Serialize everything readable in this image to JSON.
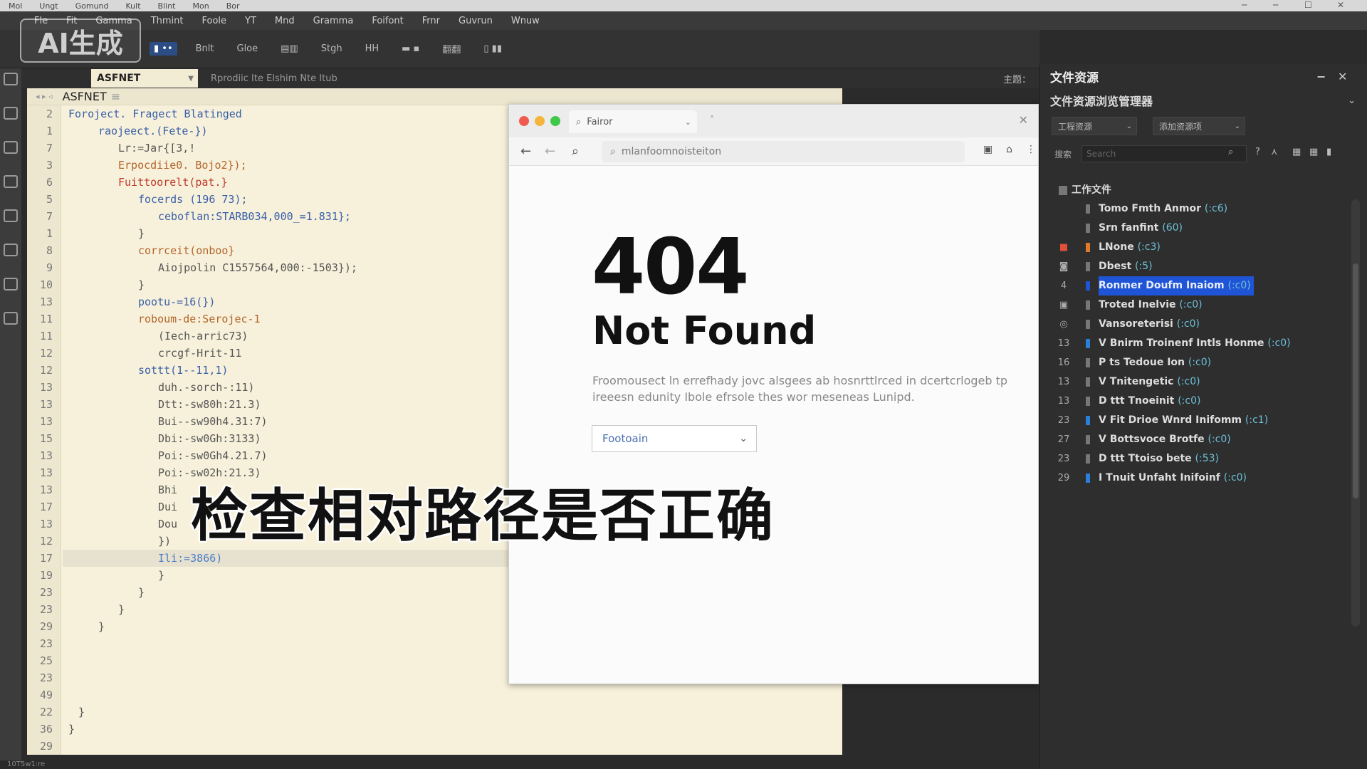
{
  "titlebar": {
    "items": [
      "Mol",
      "Ungt",
      "Gomund",
      "Kult",
      "Blint",
      "Mon",
      "Bor"
    ],
    "minimize": "─",
    "maximize": "☐",
    "close": "✕"
  },
  "watermark": "AI生成",
  "menubar": {
    "items": [
      "Fle",
      "Fit",
      "Gamma",
      "Thmint",
      "Foole",
      "YT",
      "Mnd",
      "Gramma",
      "Foifont",
      "Frnr",
      "Guvrun",
      "Wnuw"
    ]
  },
  "toolbar": {
    "items": [
      "Bnlt",
      "Gloe",
      "Stgh",
      "HH",
      "翻翻"
    ]
  },
  "editor_tabs": {
    "active_tab": "ASFNET",
    "path": "Rprodiic Ite Elshim Nte Itub",
    "right_label": "主题："
  },
  "editor": {
    "header_tab": "ASFNET",
    "lines": [
      {
        "num": "2",
        "indent": 0,
        "text": "Foroject. Fragect Blatinged",
        "color": "c-kw"
      },
      {
        "num": "1",
        "indent": 3,
        "text": "raojeect.(Fete-})",
        "color": "c-kw"
      },
      {
        "num": "7",
        "indent": 5,
        "text": "Lr:=Jar{[3‚!",
        "color": "c-plain"
      },
      {
        "num": "3",
        "indent": 5,
        "text": "Erpocdiie0. Bojo2});",
        "color": "c-orange"
      },
      {
        "num": "6",
        "indent": 5,
        "text": "Fuittoorelt(pat.}",
        "color": "c-red"
      },
      {
        "num": "5",
        "indent": 7,
        "text": "focerds (196 73);",
        "color": "c-kw"
      },
      {
        "num": "7",
        "indent": 9,
        "text": "ceboflan:STARB034,000_=1.831};",
        "color": "c-kw"
      },
      {
        "num": "1",
        "indent": 7,
        "text": "}",
        "color": "c-plain"
      },
      {
        "num": "8",
        "indent": 7,
        "text": "corrceit(onboo}",
        "color": "c-orange"
      },
      {
        "num": "9",
        "indent": 9,
        "text": "Aiojpolin C1557564,000:-1503});",
        "color": "c-plain"
      },
      {
        "num": "10",
        "indent": 7,
        "text": "}",
        "color": "c-plain"
      },
      {
        "num": "13",
        "indent": 7,
        "text": "pootu-=16(})",
        "color": "c-kw"
      },
      {
        "num": "11",
        "indent": 7,
        "text": "roboum-de:Serojec-1",
        "color": "c-orange"
      },
      {
        "num": "11",
        "indent": 9,
        "text": "(Iech-arric73)",
        "color": "c-plain"
      },
      {
        "num": "12",
        "indent": 9,
        "text": "crcgf-Hrit-11",
        "color": "c-plain"
      },
      {
        "num": "12",
        "indent": 7,
        "text": "sottt(1--11,1)",
        "color": "c-kw"
      },
      {
        "num": "13",
        "indent": 9,
        "text": "duh.-sorch-:11)",
        "color": "c-plain"
      },
      {
        "num": "13",
        "indent": 9,
        "text": "Dtt:-sw80h:21.3)",
        "color": "c-plain"
      },
      {
        "num": "13",
        "indent": 9,
        "text": "Bui--sw90h4.31:7)",
        "color": "c-plain"
      },
      {
        "num": "15",
        "indent": 9,
        "text": "Dbi:-sw0Gh:3133)",
        "color": "c-plain"
      },
      {
        "num": "13",
        "indent": 9,
        "text": "Poi:-sw0Gh4.21.7)",
        "color": "c-plain"
      },
      {
        "num": "13",
        "indent": 9,
        "text": "Poi:-sw02h:21.3)",
        "color": "c-plain"
      },
      {
        "num": "13",
        "indent": 9,
        "text": "Bhi",
        "color": "c-plain"
      },
      {
        "num": "17",
        "indent": 9,
        "text": "Dui",
        "color": "c-plain"
      },
      {
        "num": "13",
        "indent": 9,
        "text": "Dou",
        "color": "c-plain"
      },
      {
        "num": "12",
        "indent": 9,
        "text": "})",
        "color": "c-plain"
      },
      {
        "num": "17",
        "indent": 9,
        "text": "Ili:=3866)",
        "color": "c-blue",
        "highlight": true
      },
      {
        "num": "19",
        "indent": 9,
        "text": "}",
        "color": "c-plain"
      },
      {
        "num": "23",
        "indent": 7,
        "text": "}",
        "color": "c-plain"
      },
      {
        "num": "23",
        "indent": 5,
        "text": "}",
        "color": "c-plain"
      },
      {
        "num": "29",
        "indent": 3,
        "text": "}",
        "color": "c-plain"
      },
      {
        "num": "23",
        "indent": 0,
        "text": "",
        "color": "c-plain"
      },
      {
        "num": "25",
        "indent": 0,
        "text": "",
        "color": "c-plain"
      },
      {
        "num": "23",
        "indent": 0,
        "text": "",
        "color": "c-plain"
      },
      {
        "num": "49",
        "indent": 0,
        "text": "",
        "color": "c-plain"
      },
      {
        "num": "22",
        "indent": 1,
        "text": "}",
        "color": "c-plain"
      },
      {
        "num": "36",
        "indent": 0,
        "text": "}",
        "color": "c-plain"
      },
      {
        "num": "29",
        "indent": 0,
        "text": "",
        "color": "c-plain"
      }
    ]
  },
  "subtitle": "检查相对路径是否正确",
  "browser": {
    "tab_title": "Fairor",
    "address": "mlanfoomnoisteiton",
    "error_code": "404",
    "error_title": "Not Found",
    "error_desc": "Froomousect ln errefhady jovc alsgees ab hosnrttlrced in dcertcrlogeb tp ireeesn edunity Ibole efrsole thes wor meseneas Lunipd.",
    "select_value": "Footoain"
  },
  "rpanel": {
    "title": "文件资源",
    "subtitle": "文件资源浏览管理器",
    "dropdown1": "工程资源",
    "dropdown2": "添加资源项",
    "search_label": "搜索",
    "search_placeholder": "Search",
    "tree_root": "工作文件",
    "tree": [
      {
        "num": "",
        "label": "Tomo Fmth Anmor",
        "count": "(:c6)",
        "bar": "#777"
      },
      {
        "num": "",
        "label": "Srn fanfint",
        "count": "(60)",
        "bar": "#777"
      },
      {
        "num": "■",
        "label": "LNone",
        "count": "(:c3)",
        "bar": "#e07a2a"
      },
      {
        "num": "◙",
        "label": "Dbest",
        "count": "(:5)",
        "bar": "#777"
      },
      {
        "num": "4",
        "label": "Ronmer Doufm Inaiom",
        "count": "(:c0)",
        "bar": "#1f54d6",
        "selected": true
      },
      {
        "num": "▣",
        "label": "Troted Inelvie",
        "count": "(:c0)",
        "bar": "#777"
      },
      {
        "num": "◎",
        "label": "Vansoreterisi",
        "count": "(:c0)",
        "bar": "#777"
      },
      {
        "num": "13",
        "label": "V Bnirm Troinenf Intls Honme",
        "count": "(:c0)",
        "bar": "#2a7fd8"
      },
      {
        "num": "16",
        "label": "P ts Tedoue Ion",
        "count": "(:c0)",
        "bar": "#777"
      },
      {
        "num": "13",
        "label": "V Tnitengetic",
        "count": "(:c0)",
        "bar": "#777"
      },
      {
        "num": "13",
        "label": "D ttt Tnoeinit",
        "count": "(:c0)",
        "bar": "#777"
      },
      {
        "num": "23",
        "label": "V Fit Drioe Wnrd Inifomm",
        "count": "(:c1)",
        "bar": "#2a7fd8"
      },
      {
        "num": "27",
        "label": "V Bottsvoce Brotfe",
        "count": "(:c0)",
        "bar": "#777"
      },
      {
        "num": "23",
        "label": "D ttt Ttoiso bete",
        "count": "(:53)",
        "bar": "#777"
      },
      {
        "num": "29",
        "label": "I Tnuit Unfaht Inifoinf",
        "count": "(:c0)",
        "bar": "#2a7fd8"
      }
    ]
  },
  "status": "10T5w1:re"
}
